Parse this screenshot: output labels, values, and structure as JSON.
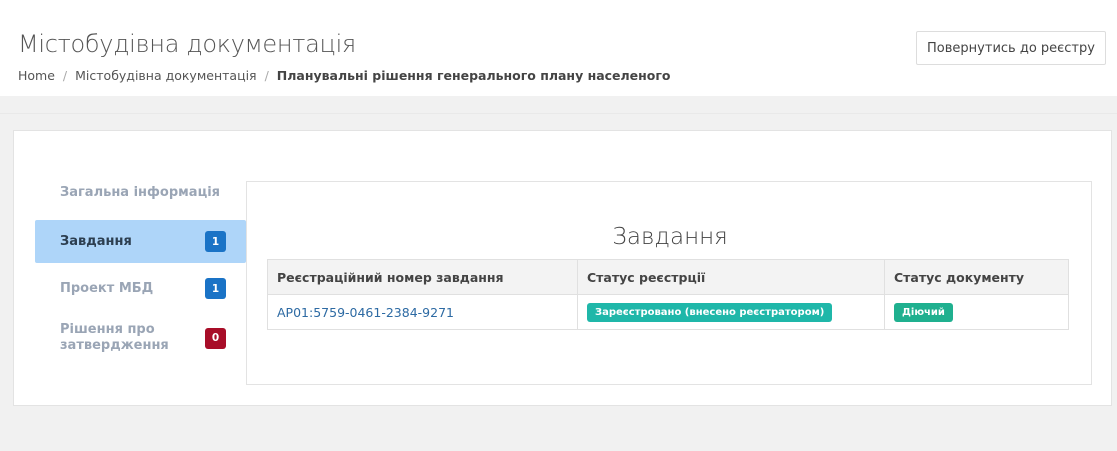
{
  "header": {
    "title": "Містобудівна документація",
    "back_button": "Повернутись до реєстру",
    "breadcrumb": {
      "home": "Home",
      "section": "Містобудівна документація",
      "current": "Планувальні рішення генерального плану населеного"
    }
  },
  "sidebar": {
    "items": [
      {
        "label": "Загальна інформація",
        "badge": null
      },
      {
        "label": "Завдання",
        "badge": "1"
      },
      {
        "label": "Проект МБД",
        "badge": "1"
      },
      {
        "label": "Рішення про затвердження",
        "badge": "0"
      }
    ]
  },
  "main": {
    "title": "Завдання",
    "table": {
      "headers": [
        "Реєстраційний номер завдання",
        "Статус реєстрції",
        "Статус документу"
      ],
      "rows": [
        {
          "reg_number": "AP01:5759-0461-2384-9271",
          "reg_status": "Зареєстровано (внесено реєстратором)",
          "doc_status": "Діючий"
        }
      ]
    }
  },
  "colors": {
    "active_nav": "#aed5f9",
    "badge_blue": "#1a73c6",
    "badge_red": "#a80d28",
    "status_teal": "#1fb7a9",
    "status_green": "#1fb08f",
    "link": "#2d6aa3"
  }
}
